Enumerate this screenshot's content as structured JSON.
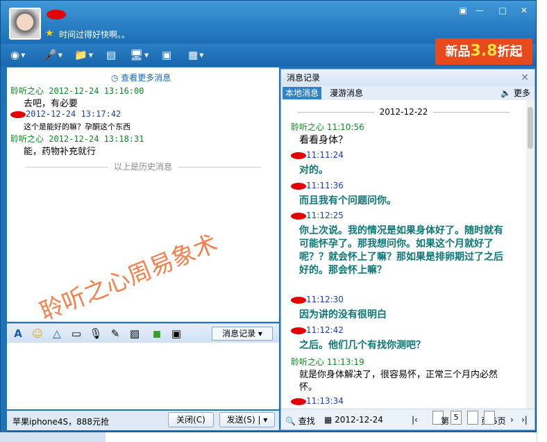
{
  "header": {
    "signature": "时间过得好快啊。。",
    "window_buttons": [
      "▣",
      "—",
      "□",
      "✕"
    ]
  },
  "toolbar": {
    "icons": [
      "camera-icon",
      "microphone-icon",
      "folder-transfer-icon",
      "sms-icon",
      "remote-desktop-icon",
      "screen-share-icon",
      "apps-icon"
    ]
  },
  "ad": {
    "prefix": "新品",
    "number": "3.8",
    "suffix": "折起"
  },
  "chat": {
    "more_messages": "查看更多消息",
    "messages": [
      {
        "head": "聆听之心 2012-12-24 13:16:00",
        "body": "去吧，有必要"
      },
      {
        "head": "2012-12-24 13:17:42",
        "body": "这个是能好的嘛？孕酮这个东西"
      },
      {
        "head": "聆听之心 2012-12-24 13:18:31",
        "body": "能，药物补充就行"
      }
    ],
    "history_divider": "以上是历史消息",
    "history_button": "消息记录",
    "watermark": "聆听之心周易象术"
  },
  "bottom": {
    "promo": "苹果iphone4S，888元抢",
    "close_button": "关闭(C)",
    "send_button": "发送(S)"
  },
  "record": {
    "title": "消息记录",
    "tabs": [
      "本地消息",
      "漫游消息"
    ],
    "more": "更多",
    "date": "2012-12-22",
    "entries": [
      {
        "head": "聆听之心 11:10:56",
        "body": "看看身体？",
        "style": "plain"
      },
      {
        "head": "11:11:24",
        "body": "对的。",
        "style": "teal"
      },
      {
        "head": "11:11:36",
        "body": "而且我有个问题问你。",
        "style": "teal"
      },
      {
        "head": "11:12:25",
        "body": "你上次说。我的情况是如果身体好了。随时就有可能怀孕了。那我想问你。如果这个月就好了呢？？就会怀上了嘛？那如果是排卵期过了之后好的。那会怀上嘛？",
        "style": "teal"
      },
      {
        "head": "11:12:30",
        "body": "因为讲的没有很明白",
        "style": "teal"
      },
      {
        "head": "11:12:42",
        "body": "之后。他们几个有找你测吧？",
        "style": "teal"
      },
      {
        "head": "聆听之心 11:13:19",
        "body": "就是你身体解决了，很容易怀，正常三个月内必然怀。",
        "style": "plain"
      },
      {
        "head": "11:13:34",
        "body": "",
        "style": "teal"
      }
    ],
    "footer": {
      "search": "查找",
      "date": "2012-12-24",
      "page_label": "第",
      "page_current": "5",
      "page_total": "页/5页"
    }
  }
}
